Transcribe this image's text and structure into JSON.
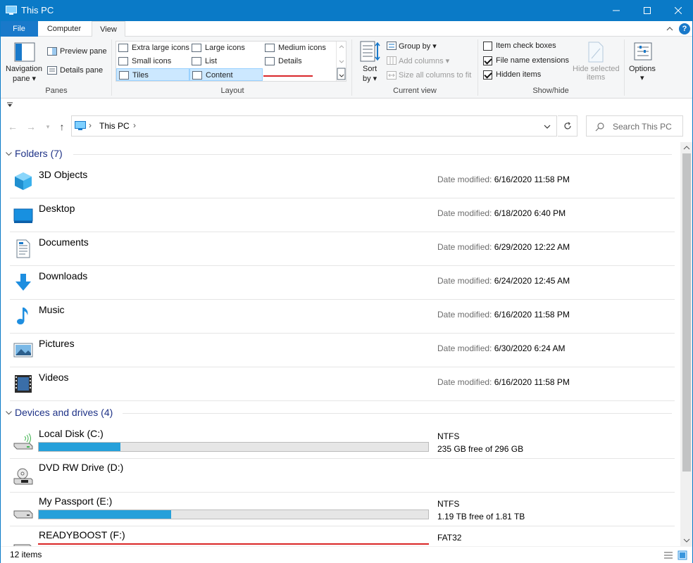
{
  "window": {
    "title": "This PC",
    "accent": "#0a7ac7"
  },
  "tabs": {
    "file": "File",
    "computer": "Computer",
    "view": "View"
  },
  "ribbon": {
    "panes": {
      "navigation_pane_line1": "Navigation",
      "navigation_pane_line2": "pane",
      "preview_pane": "Preview pane",
      "details_pane": "Details pane",
      "label": "Panes"
    },
    "layout": {
      "label": "Layout",
      "items": [
        "Extra large icons",
        "Large icons",
        "Medium icons",
        "Small icons",
        "List",
        "Details",
        "Tiles",
        "Content"
      ],
      "selected": [
        "Tiles",
        "Content"
      ]
    },
    "current_view": {
      "sort_by_line1": "Sort",
      "sort_by_line2": "by",
      "group_by": "Group by",
      "add_columns": "Add columns",
      "size_all_columns": "Size all columns to fit",
      "label": "Current view"
    },
    "show_hide": {
      "item_check_boxes": "Item check boxes",
      "file_name_extensions": "File name extensions",
      "hidden_items": "Hidden items",
      "hide_selected_line1": "Hide selected",
      "hide_selected_line2": "items",
      "label": "Show/hide",
      "checks": {
        "item_check_boxes": false,
        "file_name_extensions": true,
        "hidden_items": true
      }
    },
    "options": {
      "label": "Options"
    }
  },
  "address": {
    "path": "This PC",
    "search_placeholder": "Search This PC"
  },
  "folders": {
    "header": "Folders (7)",
    "date_label": "Date modified:",
    "items": [
      {
        "name": "3D Objects",
        "date": "6/16/2020 11:58 PM",
        "icon": "3d-objects-icon"
      },
      {
        "name": "Desktop",
        "date": "6/18/2020 6:40 PM",
        "icon": "desktop-icon"
      },
      {
        "name": "Documents",
        "date": "6/29/2020 12:22 AM",
        "icon": "documents-icon"
      },
      {
        "name": "Downloads",
        "date": "6/24/2020 12:45 AM",
        "icon": "downloads-icon"
      },
      {
        "name": "Music",
        "date": "6/16/2020 11:58 PM",
        "icon": "music-icon"
      },
      {
        "name": "Pictures",
        "date": "6/30/2020 6:24 AM",
        "icon": "pictures-icon"
      },
      {
        "name": "Videos",
        "date": "6/16/2020 11:58 PM",
        "icon": "videos-icon"
      }
    ]
  },
  "drives": {
    "header": "Devices and drives (4)",
    "items": [
      {
        "name": "Local Disk (C:)",
        "fs": "NTFS",
        "free": "235 GB free of 296 GB",
        "used_fraction": 0.21,
        "bar_color": "#26a0da"
      },
      {
        "name": "DVD RW Drive (D:)",
        "fs": "",
        "free": "",
        "used_fraction": null,
        "bar_color": ""
      },
      {
        "name": "My Passport (E:)",
        "fs": "NTFS",
        "free": "1.19 TB free of 1.81 TB",
        "used_fraction": 0.34,
        "bar_color": "#26a0da"
      },
      {
        "name": "READYBOOST (F:)",
        "fs": "FAT32",
        "free": "",
        "used_fraction": 1.0,
        "bar_color": "#da2626"
      }
    ]
  },
  "status": {
    "items": "12 items"
  }
}
